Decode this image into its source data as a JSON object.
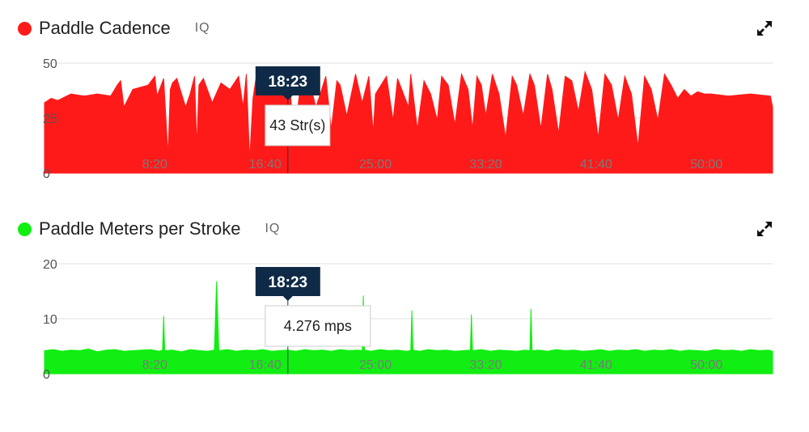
{
  "panels": [
    {
      "title": "Paddle Cadence",
      "iq_label": "IQ",
      "color": "#ff1a1a",
      "dot_color": "#ff1a1a"
    },
    {
      "title": "Paddle Meters per Stroke",
      "iq_label": "IQ",
      "color": "#11ee11",
      "dot_color": "#11ee11"
    }
  ],
  "icons": {
    "expand": "expand-arrows-icon"
  },
  "chart_data": [
    {
      "type": "area",
      "title": "Paddle Cadence",
      "ylim": [
        0,
        50
      ],
      "y_ticks": [
        0,
        25,
        50
      ],
      "x_range_seconds": [
        0,
        3300
      ],
      "x_tick_seconds": [
        500,
        1000,
        1500,
        2000,
        2500,
        3000
      ],
      "x_tick_labels": [
        "8:20",
        "16:40",
        "25:00",
        "33:20",
        "41:40",
        "50:00"
      ],
      "cursor": {
        "time": "18:23",
        "seconds": 1103,
        "value_label": "43 Str(s)"
      },
      "x_seconds": [
        0,
        30,
        60,
        120,
        180,
        240,
        300,
        330,
        345,
        360,
        400,
        470,
        500,
        510,
        540,
        560,
        570,
        580,
        600,
        640,
        660,
        680,
        690,
        700,
        720,
        760,
        800,
        840,
        880,
        900,
        915,
        930,
        945,
        960,
        1000,
        1040,
        1080,
        1100,
        1110,
        1130,
        1160,
        1200,
        1230,
        1250,
        1275,
        1300,
        1325,
        1340,
        1370,
        1410,
        1440,
        1470,
        1490,
        1500,
        1550,
        1580,
        1600,
        1650,
        1660,
        1690,
        1720,
        1750,
        1780,
        1800,
        1830,
        1860,
        1890,
        1920,
        1940,
        1960,
        1980,
        2000,
        2030,
        2060,
        2090,
        2120,
        2140,
        2170,
        2200,
        2220,
        2250,
        2280,
        2300,
        2330,
        2360,
        2390,
        2420,
        2450,
        2480,
        2510,
        2540,
        2570,
        2600,
        2630,
        2660,
        2690,
        2720,
        2750,
        2780,
        2810,
        2840,
        2870,
        2900,
        2930,
        2960,
        2990,
        3020,
        3100,
        3200,
        3290,
        3300
      ],
      "y_values": [
        32,
        34,
        33,
        36,
        35,
        36,
        35,
        40,
        42,
        30,
        38,
        40,
        44,
        35,
        43,
        8,
        38,
        41,
        43,
        30,
        36,
        44,
        12,
        40,
        43,
        32,
        41,
        38,
        44,
        30,
        45,
        6,
        34,
        44,
        36,
        42,
        44,
        43,
        44,
        14,
        40,
        42,
        30,
        36,
        44,
        20,
        42,
        40,
        26,
        45,
        32,
        44,
        18,
        36,
        44,
        24,
        43,
        30,
        45,
        20,
        42,
        36,
        24,
        44,
        40,
        22,
        45,
        38,
        20,
        44,
        40,
        26,
        45,
        36,
        16,
        44,
        40,
        26,
        45,
        40,
        20,
        45,
        38,
        18,
        44,
        42,
        28,
        46,
        38,
        16,
        45,
        40,
        24,
        44,
        36,
        12,
        44,
        38,
        24,
        45,
        40,
        34,
        38,
        35,
        37,
        36,
        36,
        35,
        36,
        35,
        30
      ]
    },
    {
      "type": "area",
      "title": "Paddle Meters per Stroke",
      "ylim": [
        0,
        20
      ],
      "y_ticks": [
        0,
        10,
        20
      ],
      "x_range_seconds": [
        0,
        3300
      ],
      "x_tick_seconds": [
        500,
        1000,
        1500,
        2000,
        2500,
        3000
      ],
      "x_tick_labels": [
        "8:20",
        "16:40",
        "25:00",
        "33:20",
        "41:40",
        "50:00"
      ],
      "cursor": {
        "time": "18:23",
        "seconds": 1103,
        "value_label": "4.276 mps"
      },
      "x_seconds": [
        0,
        40,
        80,
        120,
        160,
        200,
        240,
        280,
        320,
        360,
        400,
        440,
        480,
        520,
        535,
        540,
        545,
        580,
        620,
        660,
        700,
        740,
        770,
        780,
        790,
        830,
        870,
        910,
        950,
        990,
        1030,
        1070,
        1103,
        1140,
        1180,
        1220,
        1260,
        1300,
        1340,
        1380,
        1420,
        1440,
        1445,
        1450,
        1480,
        1520,
        1560,
        1600,
        1640,
        1660,
        1665,
        1670,
        1700,
        1740,
        1780,
        1820,
        1860,
        1900,
        1930,
        1935,
        1940,
        1980,
        2020,
        2060,
        2100,
        2140,
        2180,
        2200,
        2205,
        2210,
        2240,
        2280,
        2320,
        2360,
        2400,
        2440,
        2480,
        2520,
        2560,
        2600,
        2640,
        2680,
        2720,
        2760,
        2800,
        2840,
        2880,
        2920,
        2960,
        3000,
        3040,
        3080,
        3120,
        3160,
        3200,
        3240,
        3280,
        3300
      ],
      "y_values": [
        4.2,
        4.4,
        4.1,
        4.3,
        4.2,
        4.5,
        4.0,
        4.3,
        4.4,
        4.1,
        4.2,
        4.3,
        4.4,
        4.1,
        4.3,
        10.5,
        4.2,
        4.3,
        4.0,
        4.4,
        4.2,
        4.1,
        4.3,
        16.8,
        4.2,
        4.4,
        4.1,
        4.3,
        4.2,
        4.4,
        4.1,
        4.2,
        4.3,
        4.1,
        4.4,
        4.2,
        4.3,
        4.1,
        4.4,
        4.2,
        4.3,
        4.2,
        14.2,
        4.3,
        4.1,
        4.4,
        4.2,
        4.3,
        4.1,
        4.2,
        11.5,
        4.3,
        4.1,
        4.4,
        4.2,
        4.3,
        4.1,
        4.2,
        4.3,
        10.8,
        4.2,
        4.4,
        4.1,
        4.3,
        4.2,
        4.1,
        4.3,
        4.2,
        11.8,
        4.2,
        4.3,
        4.1,
        4.4,
        4.2,
        4.3,
        4.1,
        4.2,
        4.4,
        4.1,
        4.3,
        4.2,
        4.4,
        4.1,
        4.3,
        4.2,
        4.4,
        4.1,
        4.3,
        4.2,
        4.1,
        4.4,
        4.2,
        4.3,
        4.1,
        4.4,
        4.2,
        4.3,
        4.1
      ]
    }
  ]
}
